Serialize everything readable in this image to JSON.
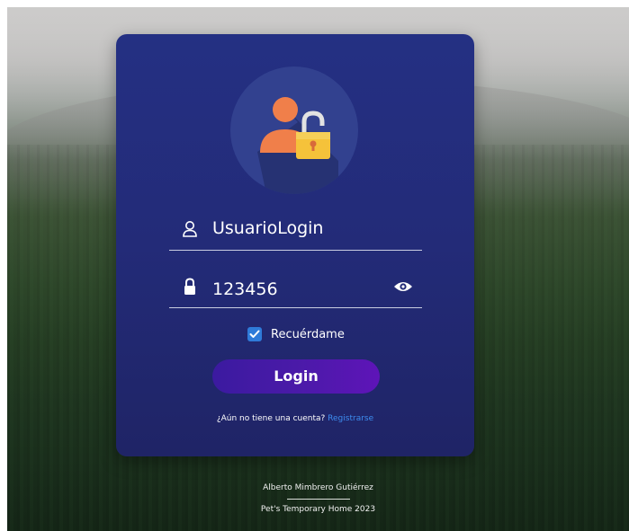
{
  "form": {
    "username_value": "UsuarioLogin",
    "password_value": "123456",
    "remember_label": "Recuérdame",
    "remember_checked": true,
    "login_label": "Login",
    "signup_prompt": "¿Aún no tiene una cuenta?",
    "signup_link": "Registrarse"
  },
  "icons": {
    "avatar": "user-lock-icon",
    "username": "user-icon",
    "password": "lock-icon",
    "toggle_password": "eye-icon",
    "checkbox": "check-icon"
  },
  "footer": {
    "author": "Alberto Mimbrero Gutiérrez",
    "copyright": "Pet's Temporary Home 2023"
  },
  "colors": {
    "card": "#232b78",
    "avatar_circle": "#32418f",
    "login_button": "#4a1aa8",
    "link": "#3d8df0",
    "checkbox": "#2f7bd9"
  }
}
